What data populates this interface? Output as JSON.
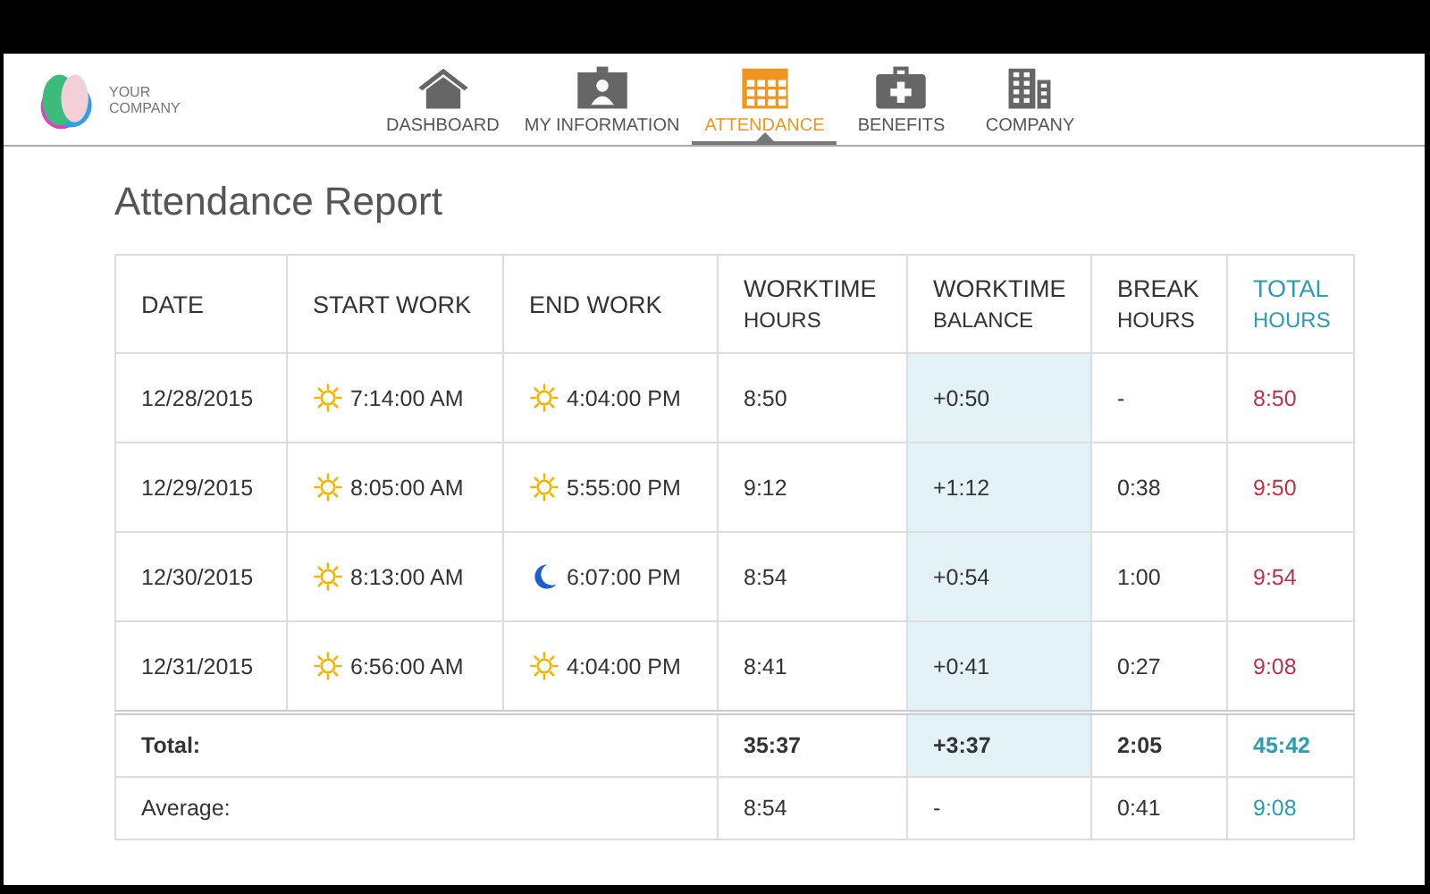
{
  "logo": {
    "text_line_1": "YOUR",
    "text_line_2": "COMPANY"
  },
  "nav": [
    {
      "label": "DASHBOARD",
      "selected": false
    },
    {
      "label": "MY INFORMATION",
      "selected": false
    },
    {
      "label": "ATTENDANCE",
      "selected": true
    },
    {
      "label": "BENEFITS",
      "selected": false
    },
    {
      "label": "COMPANY",
      "selected": false
    }
  ],
  "title": "Attendance Report",
  "table": {
    "columns": [
      {
        "line_1": "DATE"
      },
      {
        "line_1": "START WORK"
      },
      {
        "line_1": "END WORK"
      },
      {
        "line_1": "WORKTIME",
        "line_2": "HOURS"
      },
      {
        "line_1": "WORKTIME",
        "line_2": "BALANCE"
      },
      {
        "line_1": "BREAK",
        "line_2": "HOURS"
      },
      {
        "line_1": "TOTAL",
        "line_2": "HOURS"
      }
    ],
    "rows": [
      {
        "date": "12/28/2015",
        "start": {
          "kind": "day",
          "time": "7:14:00 AM"
        },
        "end": {
          "kind": "day",
          "time": "4:04:00 PM"
        },
        "worktime": "8:50",
        "balance": "+0:50",
        "break": "-",
        "total": "8:50"
      },
      {
        "date": "12/29/2015",
        "start": {
          "kind": "day",
          "time": "8:05:00 AM"
        },
        "end": {
          "kind": "day",
          "time": "5:55:00 PM"
        },
        "worktime": "9:12",
        "balance": "+1:12",
        "break": "0:38",
        "total": "9:50"
      },
      {
        "date": "12/30/2015",
        "start": {
          "kind": "day",
          "time": "8:13:00 AM"
        },
        "end": {
          "kind": "night",
          "time": "6:07:00 PM"
        },
        "worktime": "8:54",
        "balance": "+0:54",
        "break": "1:00",
        "total": "9:54"
      },
      {
        "date": "12/31/2015",
        "start": {
          "kind": "day",
          "time": "6:56:00 AM"
        },
        "end": {
          "kind": "day",
          "time": "4:04:00 PM"
        },
        "worktime": "8:41",
        "balance": "+0:41",
        "break": "0:27",
        "total": "9:08"
      }
    ],
    "summary": [
      {
        "kind": "total",
        "label": "Total:",
        "worktime": "35:37",
        "balance": "+3:37",
        "break": "2:05",
        "total": "45:42"
      },
      {
        "kind": "average",
        "label": "Average:",
        "worktime": "8:54",
        "balance": "-",
        "break": "0:41",
        "total": "9:08"
      }
    ]
  }
}
